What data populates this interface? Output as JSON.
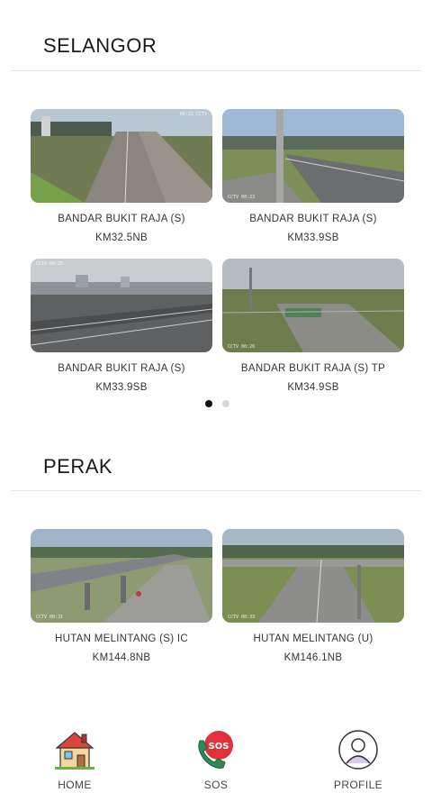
{
  "sections": [
    {
      "title": "SELANGOR",
      "cameras": [
        {
          "name": "BANDAR BUKIT RAJA (S)",
          "km": "KM32.5NB"
        },
        {
          "name": "BANDAR BUKIT RAJA (S)",
          "km": "KM33.9SB"
        },
        {
          "name": "BANDAR BUKIT RAJA (S)",
          "km": "KM33.9SB"
        },
        {
          "name": "BANDAR BUKIT RAJA (S) TP",
          "km": "KM34.9SB"
        }
      ],
      "pager": {
        "pages": 2,
        "active": 1
      }
    },
    {
      "title": "PERAK",
      "cameras": [
        {
          "name": "HUTAN MELINTANG (S) IC",
          "km": "KM144.8NB"
        },
        {
          "name": "HUTAN MELINTANG (U)",
          "km": "KM146.1NB"
        }
      ]
    }
  ],
  "nav": [
    {
      "label": "HOME",
      "icon": "house-icon"
    },
    {
      "label": "SOS",
      "icon": "sos-phone-icon"
    },
    {
      "label": "PROFILE",
      "icon": "user-profile-icon"
    }
  ],
  "colors": {
    "sos_red": "#e0323a",
    "sos_green": "#2e8b57",
    "pager_active": "#111111",
    "pager_inactive": "#d7d7d7"
  }
}
